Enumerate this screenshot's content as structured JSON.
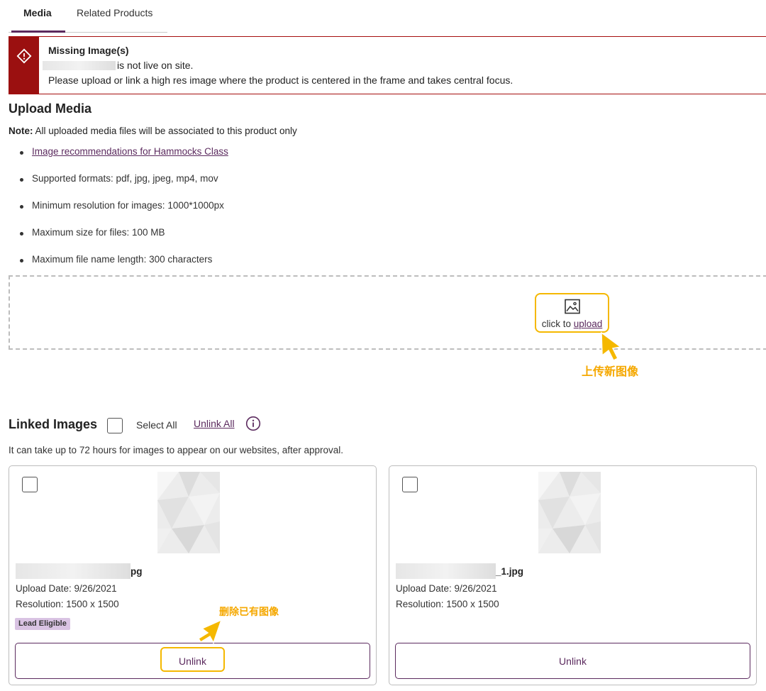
{
  "tabs": [
    {
      "label": "Media",
      "active": true
    },
    {
      "label": "Related Products",
      "active": false
    }
  ],
  "alert": {
    "title": "Missing Image(s)",
    "line1_suffix": "is not live on site.",
    "line2": "Please upload or link a high res image where the product is centered in the frame and takes central focus.",
    "icon": "warning-diamond-icon",
    "color": "#9b1010"
  },
  "upload": {
    "title": "Upload Media",
    "note_label": "Note:",
    "note_text": " All uploaded media files will be associated to this product only",
    "link_text": "Image recommendations for Hammocks Class",
    "requirements": [
      "Supported formats: pdf, jpg, jpeg, mp4, mov",
      "Minimum resolution for images: 1000*1000px",
      "Maximum size for files: 100 MB",
      "Maximum file name length: 300 characters"
    ],
    "click_to": "click to ",
    "upload_link": "upload"
  },
  "annotations": {
    "upload_new": "上传新图像",
    "delete_existing": "删除已有图像",
    "color": "#f5a800"
  },
  "linked": {
    "title": "Linked Images",
    "select_all": "Select All",
    "unlink_all": "Unlink All",
    "approval_note": "It can take up to 72 hours for images to appear on our websites, after approval.",
    "cards": [
      {
        "filename_suffix": "pg",
        "upload_date": "Upload Date: 9/26/2021",
        "resolution": "Resolution: 1500 x 1500",
        "badge": "Lead Eligible",
        "unlink": "Unlink"
      },
      {
        "filename_suffix": "_1.jpg",
        "upload_date": "Upload Date: 9/26/2021",
        "resolution": "Resolution: 1500 x 1500",
        "badge": "",
        "unlink": "Unlink"
      }
    ]
  },
  "colors": {
    "accent": "#5b2a5e",
    "highlight": "#f5b800",
    "badge_bg": "#d9c3e3"
  }
}
